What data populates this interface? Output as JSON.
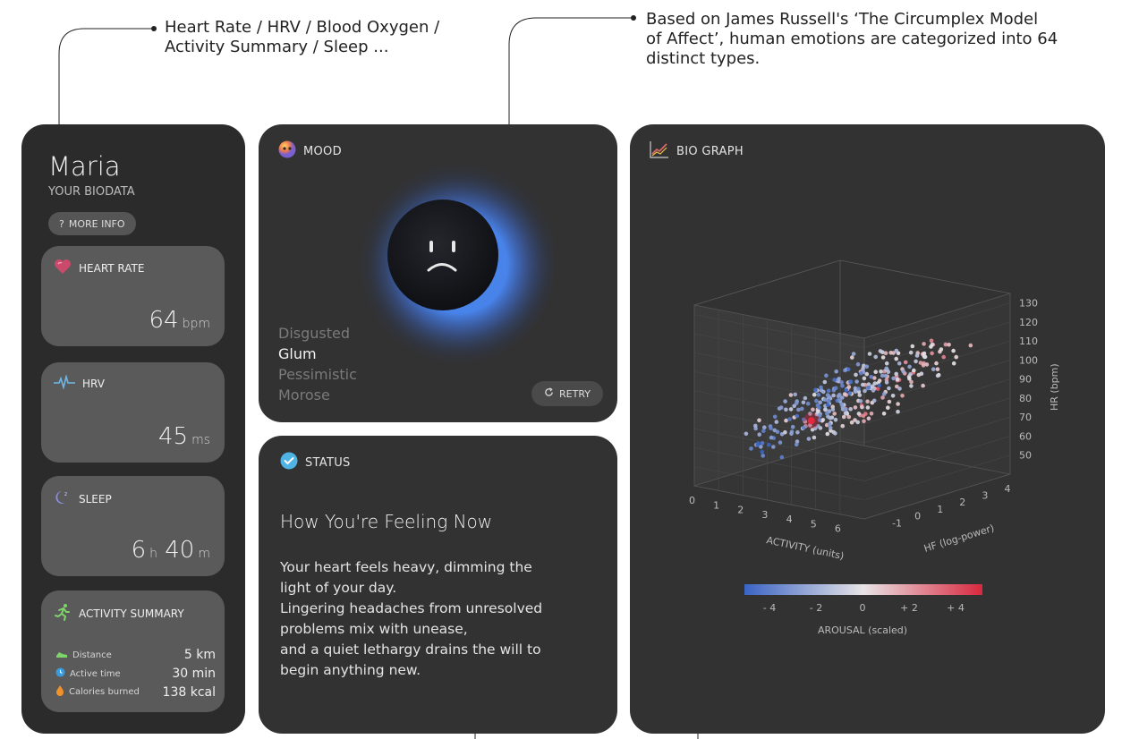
{
  "annotations": {
    "left": {
      "line1": "Heart Rate / HRV / Blood Oxygen /",
      "line2": "Activity Summary / Sleep ..."
    },
    "right": {
      "line1": "Based on James Russell's ‘The Circumplex Model",
      "line2": "of Affect’, human emotions are categorized into 64",
      "line3": "distinct types."
    }
  },
  "profile": {
    "name": "Maria",
    "subtitle": "YOUR BIODATA",
    "more_info_icon": "?",
    "more_info_label": "MORE INFO"
  },
  "metrics": {
    "heart_rate": {
      "title": "HEART RATE",
      "value": "64",
      "unit": "bpm",
      "icon": "heart-icon"
    },
    "hrv": {
      "title": "HRV",
      "value": "45",
      "unit": "ms",
      "icon": "pulse-wave-icon"
    },
    "sleep": {
      "title": "SLEEP",
      "hours": "6",
      "h_unit": "h",
      "minutes": "40",
      "m_unit": "m",
      "icon": "moon-sleep-icon"
    },
    "activity": {
      "title": "ACTIVITY SUMMARY",
      "icon": "running-icon",
      "rows": [
        {
          "label": "Distance",
          "value": "5 km",
          "icon": "shoe-icon"
        },
        {
          "label": "Active time",
          "value": "30 min",
          "icon": "clock-icon"
        },
        {
          "label": "Calories burned",
          "value": "138 kcal",
          "icon": "flame-icon"
        }
      ]
    }
  },
  "mood": {
    "title": "MOOD",
    "icon": "emoji-face-icon",
    "words": [
      "Disgusted",
      "Glum",
      "Pessimistic",
      "Morose"
    ],
    "selected_index": 1,
    "retry_label": "RETRY"
  },
  "status": {
    "title": "STATUS",
    "heading": "How You're Feeling Now",
    "body_lines": [
      "Your heart feels heavy, dimming the",
      "light of your day.",
      "Lingering headaches from unresolved",
      "problems mix with unease,",
      "and a quiet lethargy drains the will to",
      "begin anything new."
    ]
  },
  "bio_graph": {
    "title": "BIO GRAPH",
    "icon": "line-chart-icon"
  },
  "chart_data": {
    "type": "scatter",
    "x_label": "ACTIVITY (units)",
    "x_ticks": [
      "0",
      "1",
      "2",
      "3",
      "4",
      "5",
      "6"
    ],
    "y_label": "HF (log-power)",
    "y_ticks": [
      "-1",
      "0",
      "1",
      "2",
      "3",
      "4"
    ],
    "z_label": "HR (bpm)",
    "z_ticks": [
      "130",
      "120",
      "110",
      "100",
      "90",
      "80",
      "70",
      "60",
      "50"
    ],
    "colorbar_label": "AROUSAL (scaled)",
    "colorbar_ticks": [
      "- 4",
      "- 2",
      "0",
      "+ 2",
      "+ 4"
    ],
    "colorbar_range": [
      -4,
      4
    ],
    "colors": {
      "low": "#3a64c4",
      "mid": "#e8e4e6",
      "high": "#d8283e"
    },
    "highlight_point": {
      "activity": 2.6,
      "hf": 0.4,
      "hr": 72
    }
  }
}
